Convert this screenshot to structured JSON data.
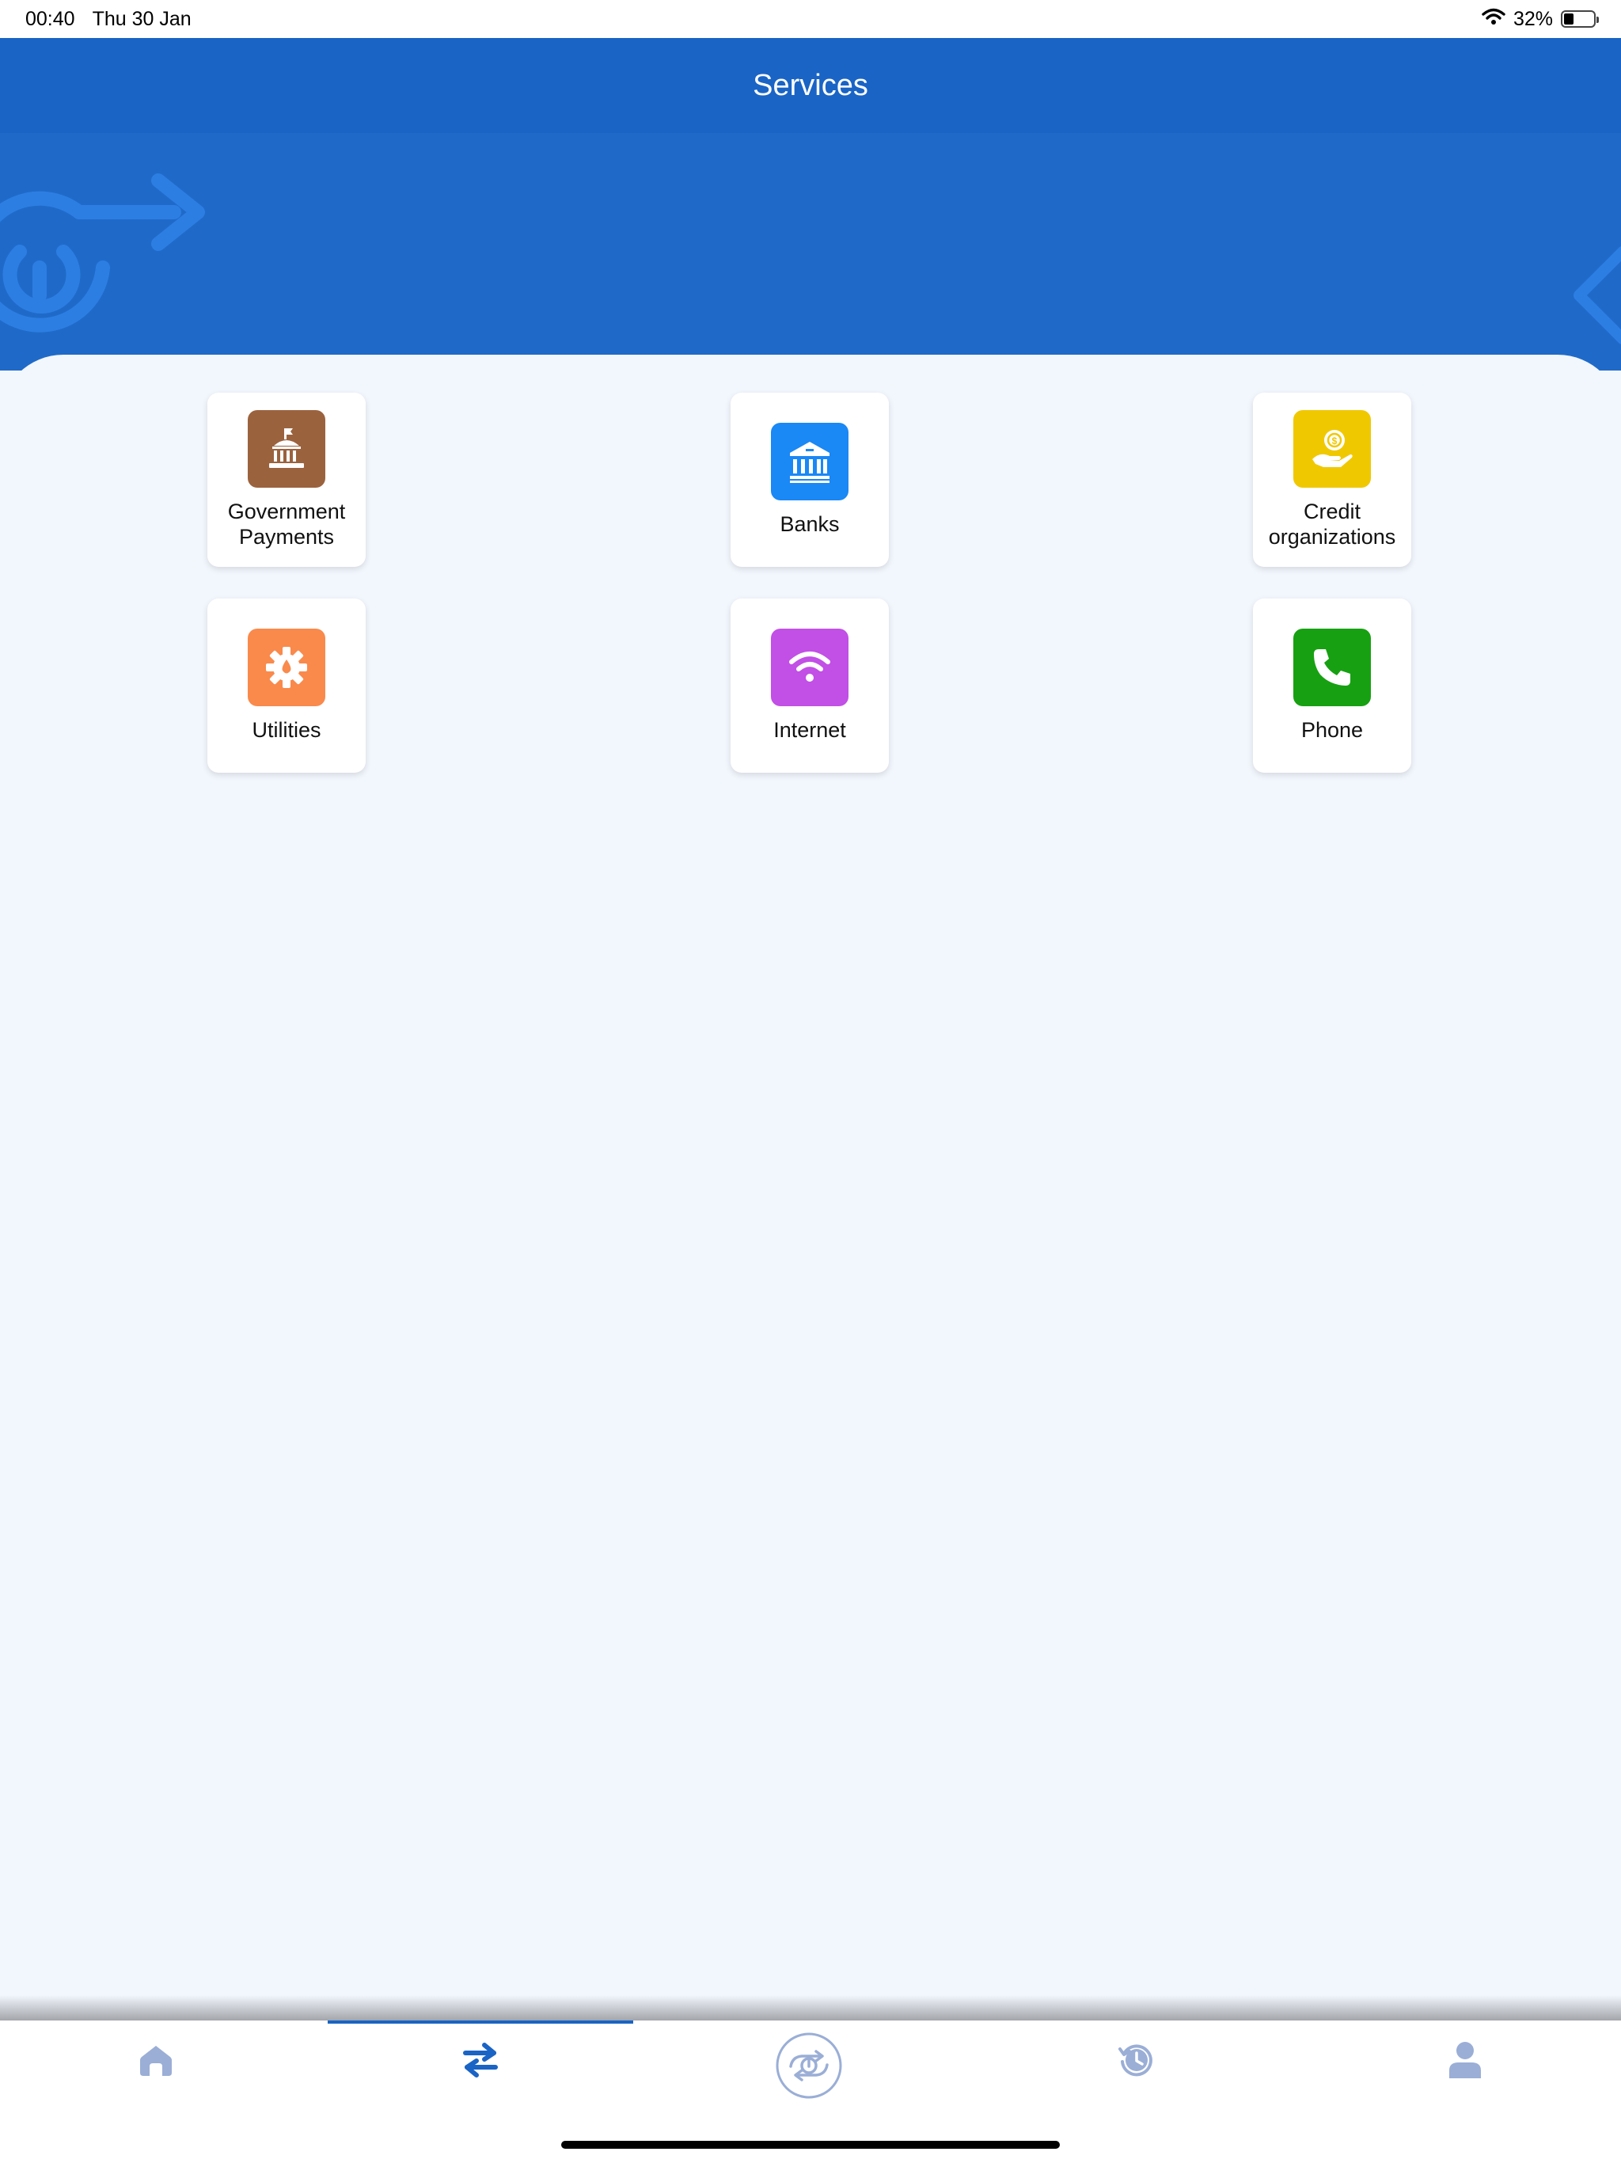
{
  "status_bar": {
    "time": "00:40",
    "date": "Thu 30 Jan",
    "battery": "32%",
    "icons": [
      "wifi-icon",
      "battery-icon"
    ]
  },
  "header": {
    "title": "Services"
  },
  "services": [
    {
      "label": "Government\nPayments",
      "icon": "government-building-icon",
      "color": "#9b623e"
    },
    {
      "label": "Banks",
      "icon": "bank-icon",
      "color": "#1a88f5"
    },
    {
      "label": "Credit\norganizations",
      "icon": "money-hand-icon",
      "color": "#f0c800"
    },
    {
      "label": "Utilities",
      "icon": "utility-gear-icon",
      "color": "#f98a4c"
    },
    {
      "label": "Internet",
      "icon": "wifi-icon",
      "color": "#c24fe6"
    },
    {
      "label": "Phone",
      "icon": "phone-icon",
      "color": "#17a112"
    }
  ],
  "bottom_nav": {
    "items": [
      "home-icon",
      "transfer-arrows-icon",
      "app-logo-icon",
      "history-clock-icon",
      "profile-icon"
    ],
    "active": "transfer-arrows-icon",
    "active_color": "#1a64c5",
    "inactive_color": "#9aaed6"
  }
}
